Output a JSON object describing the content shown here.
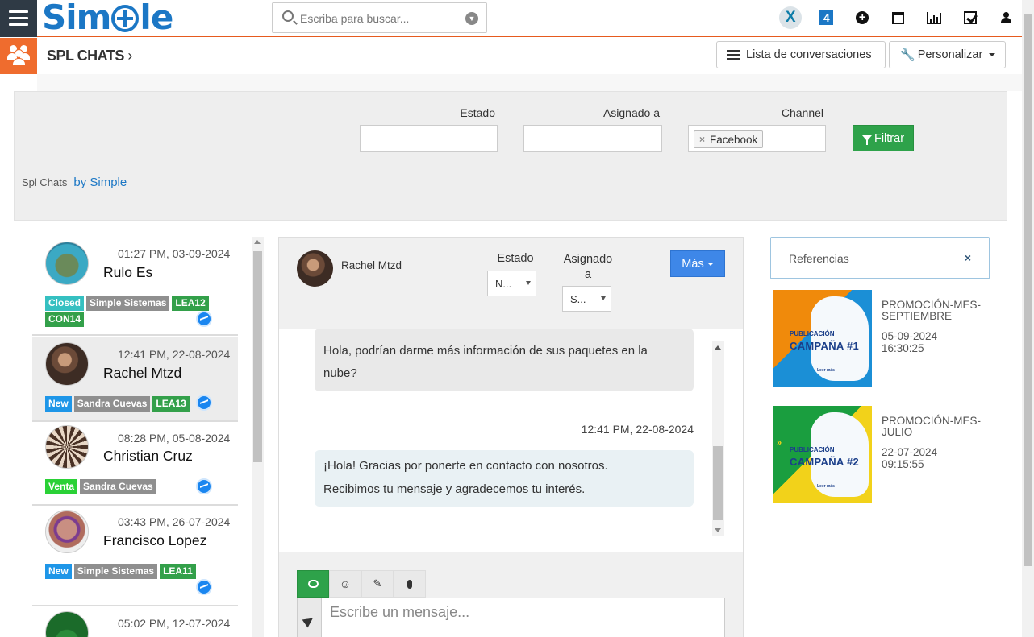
{
  "app": {
    "logo_text": "Simple"
  },
  "search": {
    "placeholder": "Escriba para buscar..."
  },
  "topbar_icons": [
    "x-app-icon",
    "four-app-icon",
    "plus-circle-icon",
    "calendar-icon",
    "bar-chart-icon",
    "check-square-icon",
    "user-icon"
  ],
  "module": {
    "title": "SPL CHATS",
    "chevron": "›"
  },
  "toolbar": {
    "list_label": "Lista de conversaciones",
    "customize_label": "Personalizar"
  },
  "filters": {
    "estado_label": "Estado",
    "asignado_label": "Asignado a",
    "channel_label": "Channel",
    "channel_tag": "Facebook",
    "filter_button": "Filtrar"
  },
  "brand": {
    "prefix": "Spl Chats",
    "by": "by Simple"
  },
  "chats": [
    {
      "time": "01:27 PM, 03-09-2024",
      "name": "Rulo Es",
      "tags": [
        {
          "text": "Closed",
          "color": "teal"
        },
        {
          "text": "Simple Sistemas",
          "color": "grey"
        },
        {
          "text": "LEA12",
          "color": "green"
        },
        {
          "text": "CON14",
          "color": "green"
        }
      ]
    },
    {
      "time": "12:41 PM, 22-08-2024",
      "name": "Rachel Mtzd",
      "tags": [
        {
          "text": "New",
          "color": "blue"
        },
        {
          "text": "Sandra Cuevas",
          "color": "grey"
        },
        {
          "text": "LEA13",
          "color": "green"
        }
      ]
    },
    {
      "time": "08:28 PM, 05-08-2024",
      "name": "Christian Cruz",
      "tags": [
        {
          "text": "Venta",
          "color": "lime"
        },
        {
          "text": "Sandra Cuevas",
          "color": "grey"
        }
      ]
    },
    {
      "time": "03:43 PM, 26-07-2024",
      "name": "Francisco Lopez",
      "tags": [
        {
          "text": "New",
          "color": "blue"
        },
        {
          "text": "Simple Sistemas",
          "color": "grey"
        },
        {
          "text": "LEA11",
          "color": "green"
        }
      ]
    },
    {
      "time": "05:02 PM, 12-07-2024",
      "name": "",
      "tags": []
    }
  ],
  "conversation": {
    "contact_name": "Rachel Mtzd",
    "estado_label": "Estado",
    "estado_value": "N...",
    "asignado_label_1": "Asignado",
    "asignado_label_2": "a",
    "asignado_value": "S...",
    "more_button": "Más",
    "messages": [
      {
        "direction": "in",
        "line1": "Hola, podrían darme más información de sus paquetes en la",
        "line2": "nube?"
      },
      {
        "direction": "out",
        "time": "12:41 PM, 22-08-2024",
        "line1": "¡Hola! Gracias por ponerte en contacto con nosotros.",
        "line2": "Recibimos tu mensaje y agradecemos tu interés."
      }
    ],
    "composer_placeholder": "Escribe un mensaje..."
  },
  "references": {
    "title": "Referencias",
    "close": "×",
    "items": [
      {
        "title": "PROMOCIÓN-MES-SEPTIEMBRE",
        "date": "05-09-2024",
        "time": "16:30:25",
        "img_kicker": "PUBLICACIÓN",
        "img_title": "CAMPAÑA #1",
        "img_cta": "Leer más",
        "img_bg": "#f08a0b"
      },
      {
        "title": "PROMOCIÓN-MES-JULIO",
        "date": "22-07-2024",
        "time": "09:15:55",
        "img_kicker": "PUBLICACIÓN",
        "img_title": "CAMPAÑA #2",
        "img_cta": "Leer más",
        "img_bg": "#1a9e3f"
      }
    ]
  }
}
